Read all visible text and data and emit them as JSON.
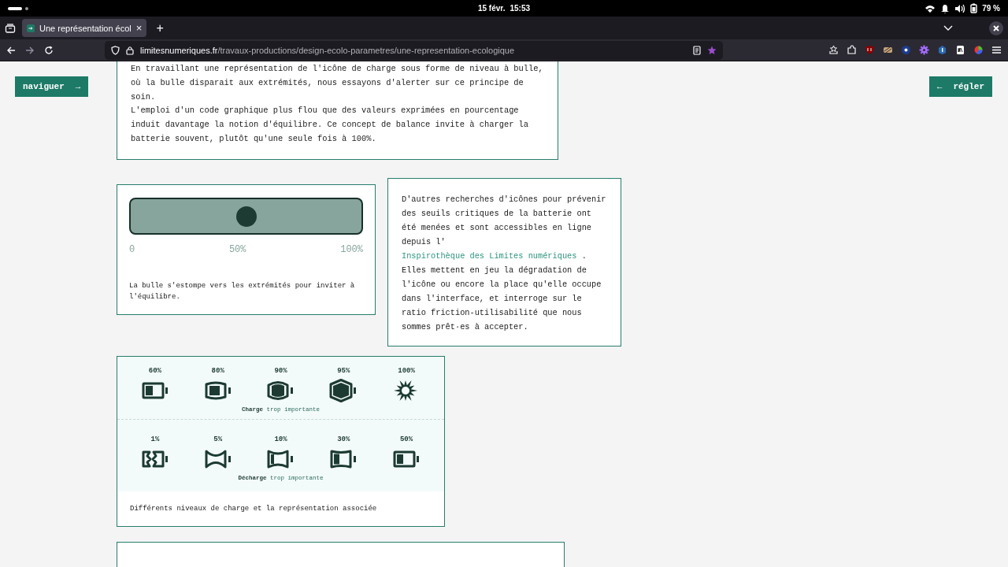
{
  "system_bar": {
    "date": "15 févr.",
    "time": "15:53",
    "battery": "79 %"
  },
  "browser": {
    "tabs": [
      {
        "title": "Une représentation écol",
        "close": "×",
        "selected": true
      }
    ],
    "new_tab": "+",
    "url_host": "limitesnumeriques.fr",
    "url_path": "/travaux-productions/design-ecolo-parametres/une-representation-ecologique"
  },
  "side_buttons": [
    {
      "label": "naviguer",
      "arrow": "→",
      "kind": "navigate"
    },
    {
      "label": "régler",
      "arrow": "←",
      "kind": "settings"
    }
  ],
  "intro": {
    "paragraphs": [
      "En travaillant une représentation de l'icône de charge sous forme de niveau à bulle, où la bulle disparait aux extrémités, nous essayons d'alerter sur ce principe de soin.",
      "L'emploi d'un code graphique plus flou que des valeurs exprimées en pourcentage induit davantage la notion d'équilibre. Ce concept de balance invite à charger la batterie souvent, plutôt qu'une seule fois à 100%."
    ]
  },
  "level_card": {
    "level": 0.5,
    "ticks": [
      "0",
      "50%",
      "100%"
    ],
    "caption": "La bulle s'estompe vers les extrémités pour inviter à l'équilibre."
  },
  "research_card": {
    "text_before": "D'autres recherches d'icônes pour prévenir des seuils critiques de la batterie ont été menées et sont accessibles en ligne depuis l' ",
    "link": "Inspirothèque des Limites numériques",
    "text_after": " . Elles mettent en jeu la dégradation de l'icône ou encore la place qu'elle occupe dans l'interface, et interroge sur le ratio friction-utilisabilité que nous sommes prêt·es à accepter."
  },
  "figure": {
    "groups": [
      {
        "label": "**Charge** trop importante",
        "items": [
          {
            "label": "60%",
            "kind": "partial"
          },
          {
            "label": "80%",
            "kind": "swollen"
          },
          {
            "label": "90%",
            "kind": "bulging"
          },
          {
            "label": "95%",
            "kind": "hexagonal"
          },
          {
            "label": "100%",
            "kind": "burst"
          }
        ]
      },
      {
        "label": "**Décharge** trop importante",
        "items": [
          {
            "label": "1%",
            "kind": "cracked"
          },
          {
            "label": "5%",
            "kind": "pinched"
          },
          {
            "label": "10%",
            "kind": "narrowed"
          },
          {
            "label": "30%",
            "kind": "concave"
          },
          {
            "label": "50%",
            "kind": "half"
          }
        ]
      }
    ],
    "caption": "Différents niveaux de charge et la représentation associée"
  }
}
